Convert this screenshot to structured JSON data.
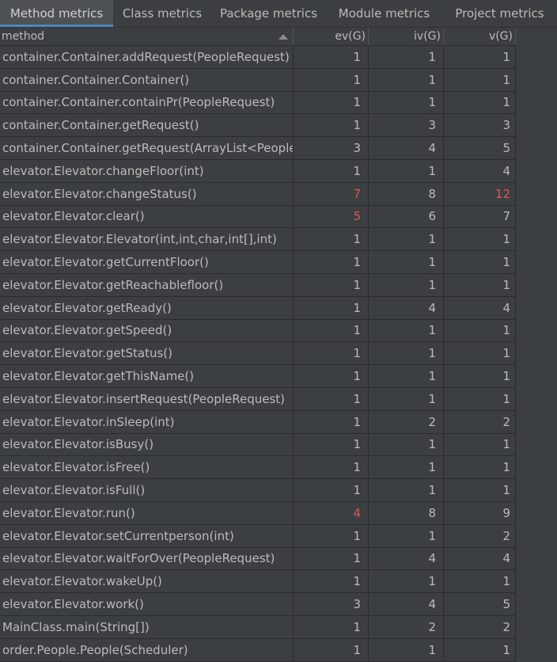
{
  "tabs": [
    {
      "label": "Method metrics",
      "active": true
    },
    {
      "label": "Class metrics",
      "active": false
    },
    {
      "label": "Package metrics",
      "active": false
    },
    {
      "label": "Module metrics",
      "active": false
    },
    {
      "label": "Project metrics",
      "active": false
    }
  ],
  "table": {
    "columns": {
      "method": "method",
      "ev": "ev(G)",
      "iv": "iv(G)",
      "v": "v(G)"
    },
    "sort_indicator": "sort-ascending-icon",
    "highlight_color": "#e05555",
    "rows": [
      {
        "method": "container.Container.addRequest(PeopleRequest)",
        "ev": "1",
        "iv": "1",
        "v": "1",
        "ev_red": false,
        "v_red": false
      },
      {
        "method": "container.Container.Container()",
        "ev": "1",
        "iv": "1",
        "v": "1",
        "ev_red": false,
        "v_red": false
      },
      {
        "method": "container.Container.containPr(PeopleRequest)",
        "ev": "1",
        "iv": "1",
        "v": "1",
        "ev_red": false,
        "v_red": false
      },
      {
        "method": "container.Container.getRequest()",
        "ev": "1",
        "iv": "3",
        "v": "3",
        "ev_red": false,
        "v_red": false
      },
      {
        "method": "container.Container.getRequest(ArrayList<PeopleR",
        "ev": "3",
        "iv": "4",
        "v": "5",
        "ev_red": false,
        "v_red": false
      },
      {
        "method": "elevator.Elevator.changeFloor(int)",
        "ev": "1",
        "iv": "1",
        "v": "4",
        "ev_red": false,
        "v_red": false
      },
      {
        "method": "elevator.Elevator.changeStatus()",
        "ev": "7",
        "iv": "8",
        "v": "12",
        "ev_red": true,
        "v_red": true
      },
      {
        "method": "elevator.Elevator.clear()",
        "ev": "5",
        "iv": "6",
        "v": "7",
        "ev_red": true,
        "v_red": false
      },
      {
        "method": "elevator.Elevator.Elevator(int,int,char,int[],int)",
        "ev": "1",
        "iv": "1",
        "v": "1",
        "ev_red": false,
        "v_red": false
      },
      {
        "method": "elevator.Elevator.getCurrentFloor()",
        "ev": "1",
        "iv": "1",
        "v": "1",
        "ev_red": false,
        "v_red": false
      },
      {
        "method": "elevator.Elevator.getReachablefloor()",
        "ev": "1",
        "iv": "1",
        "v": "1",
        "ev_red": false,
        "v_red": false
      },
      {
        "method": "elevator.Elevator.getReady()",
        "ev": "1",
        "iv": "4",
        "v": "4",
        "ev_red": false,
        "v_red": false
      },
      {
        "method": "elevator.Elevator.getSpeed()",
        "ev": "1",
        "iv": "1",
        "v": "1",
        "ev_red": false,
        "v_red": false
      },
      {
        "method": "elevator.Elevator.getStatus()",
        "ev": "1",
        "iv": "1",
        "v": "1",
        "ev_red": false,
        "v_red": false
      },
      {
        "method": "elevator.Elevator.getThisName()",
        "ev": "1",
        "iv": "1",
        "v": "1",
        "ev_red": false,
        "v_red": false
      },
      {
        "method": "elevator.Elevator.insertRequest(PeopleRequest)",
        "ev": "1",
        "iv": "1",
        "v": "1",
        "ev_red": false,
        "v_red": false
      },
      {
        "method": "elevator.Elevator.inSleep(int)",
        "ev": "1",
        "iv": "2",
        "v": "2",
        "ev_red": false,
        "v_red": false
      },
      {
        "method": "elevator.Elevator.isBusy()",
        "ev": "1",
        "iv": "1",
        "v": "1",
        "ev_red": false,
        "v_red": false
      },
      {
        "method": "elevator.Elevator.isFree()",
        "ev": "1",
        "iv": "1",
        "v": "1",
        "ev_red": false,
        "v_red": false
      },
      {
        "method": "elevator.Elevator.isFull()",
        "ev": "1",
        "iv": "1",
        "v": "1",
        "ev_red": false,
        "v_red": false
      },
      {
        "method": "elevator.Elevator.run()",
        "ev": "4",
        "iv": "8",
        "v": "9",
        "ev_red": true,
        "v_red": false
      },
      {
        "method": "elevator.Elevator.setCurrentperson(int)",
        "ev": "1",
        "iv": "1",
        "v": "2",
        "ev_red": false,
        "v_red": false
      },
      {
        "method": "elevator.Elevator.waitForOver(PeopleRequest)",
        "ev": "1",
        "iv": "4",
        "v": "4",
        "ev_red": false,
        "v_red": false
      },
      {
        "method": "elevator.Elevator.wakeUp()",
        "ev": "1",
        "iv": "1",
        "v": "1",
        "ev_red": false,
        "v_red": false
      },
      {
        "method": "elevator.Elevator.work()",
        "ev": "3",
        "iv": "4",
        "v": "5",
        "ev_red": false,
        "v_red": false
      },
      {
        "method": "MainClass.main(String[])",
        "ev": "1",
        "iv": "2",
        "v": "2",
        "ev_red": false,
        "v_red": false
      },
      {
        "method": "order.People.People(Scheduler)",
        "ev": "1",
        "iv": "1",
        "v": "1",
        "ev_red": false,
        "v_red": false
      }
    ]
  }
}
